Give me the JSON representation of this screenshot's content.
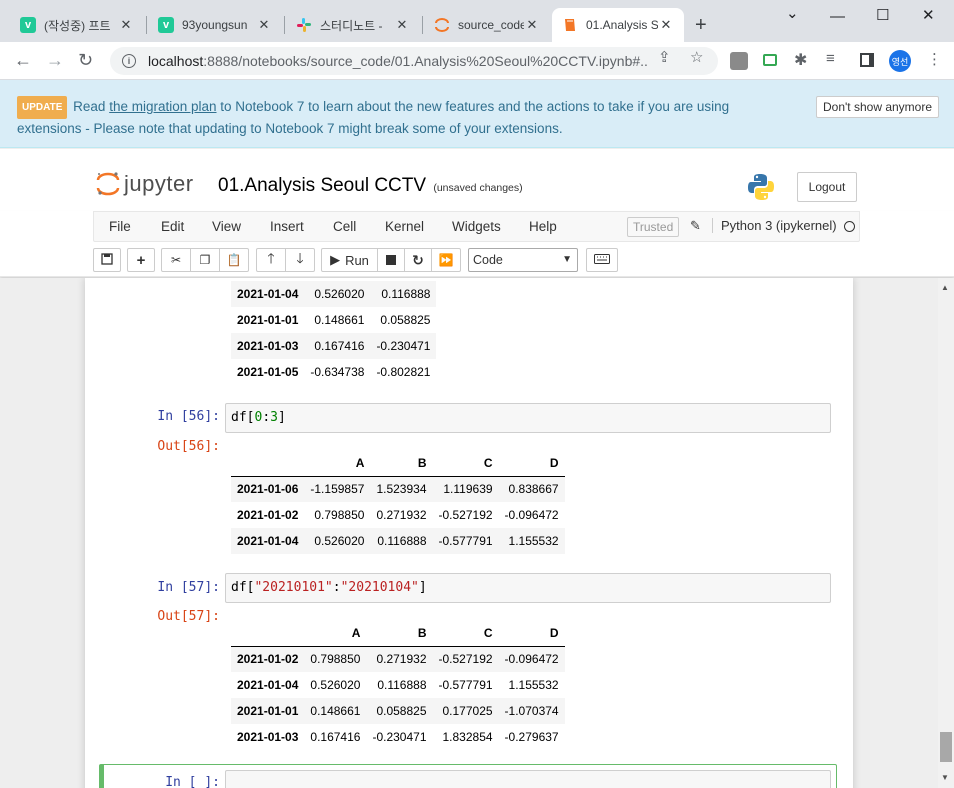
{
  "browser": {
    "tabs": [
      {
        "label": "(작성중) 프트",
        "favicon": "v"
      },
      {
        "label": "93youngsun",
        "favicon": "v"
      },
      {
        "label": "스터디노트 -",
        "favicon": "slack"
      },
      {
        "label": "source_code/",
        "favicon": "jupyter"
      },
      {
        "label": "01.Analysis S",
        "favicon": "jupyter-notebook"
      }
    ],
    "url_host": "localhost",
    "url_path": ":8888/notebooks/source_code/01.Analysis%20Seoul%20CCTV.ipynb#...",
    "profile_label": "영선"
  },
  "banner": {
    "badge": "UPDATE",
    "text_before": "Read",
    "link": "the migration plan",
    "text_after": "to Notebook 7 to learn about the new features and the actions to take if you are using extensions - Please note that updating to Notebook 7 might break some of your extensions.",
    "dismiss": "Don't show anymore"
  },
  "header": {
    "logo_word": "jupyter",
    "title": "01.Analysis Seoul CCTV",
    "autosave": "(unsaved changes)",
    "logout": "Logout"
  },
  "menu": {
    "items": [
      "File",
      "Edit",
      "View",
      "Insert",
      "Cell",
      "Kernel",
      "Widgets",
      "Help"
    ],
    "trusted": "Trusted",
    "kernel": "Python 3 (ipykernel)"
  },
  "toolbar": {
    "run": "Run",
    "cell_type": "Code"
  },
  "cells": {
    "top_table": {
      "rows": [
        [
          "2021-01-04",
          "0.526020",
          "0.116888"
        ],
        [
          "2021-01-01",
          "0.148661",
          "0.058825"
        ],
        [
          "2021-01-03",
          "0.167416",
          "-0.230471"
        ],
        [
          "2021-01-05",
          "-0.634738",
          "-0.802821"
        ]
      ]
    },
    "cell56": {
      "in_prompt": "In [56]:",
      "out_prompt": "Out[56]:",
      "code_plain": "df[",
      "code_num1": "0",
      "code_colon": ":",
      "code_num2": "3",
      "code_end": "]",
      "columns": [
        "A",
        "B",
        "C",
        "D"
      ],
      "rows": [
        [
          "2021-01-06",
          "-1.159857",
          "1.523934",
          "1.119639",
          "0.838667"
        ],
        [
          "2021-01-02",
          "0.798850",
          "0.271932",
          "-0.527192",
          "-0.096472"
        ],
        [
          "2021-01-04",
          "0.526020",
          "0.116888",
          "-0.577791",
          "1.155532"
        ]
      ]
    },
    "cell57": {
      "in_prompt": "In [57]:",
      "out_prompt": "Out[57]:",
      "code_plain": "df[",
      "code_str1": "\"20210101\"",
      "code_colon": ":",
      "code_str2": "\"20210104\"",
      "code_end": "]",
      "columns": [
        "A",
        "B",
        "C",
        "D"
      ],
      "rows": [
        [
          "2021-01-02",
          "0.798850",
          "0.271932",
          "-0.527192",
          "-0.096472"
        ],
        [
          "2021-01-04",
          "0.526020",
          "0.116888",
          "-0.577791",
          "1.155532"
        ],
        [
          "2021-01-01",
          "0.148661",
          "0.058825",
          "0.177025",
          "-1.070374"
        ],
        [
          "2021-01-03",
          "0.167416",
          "-0.230471",
          "1.832854",
          "-0.279637"
        ]
      ]
    },
    "empty_cell": {
      "in_prompt": "In [ ]:"
    }
  },
  "colors": {
    "banner_bg": "#d9edf7",
    "banner_text": "#31708f",
    "update_badge": "#f0ad4e",
    "in_prompt": "#303f9f",
    "out_prompt": "#d84315",
    "selected_cell": "#66bb6a"
  }
}
